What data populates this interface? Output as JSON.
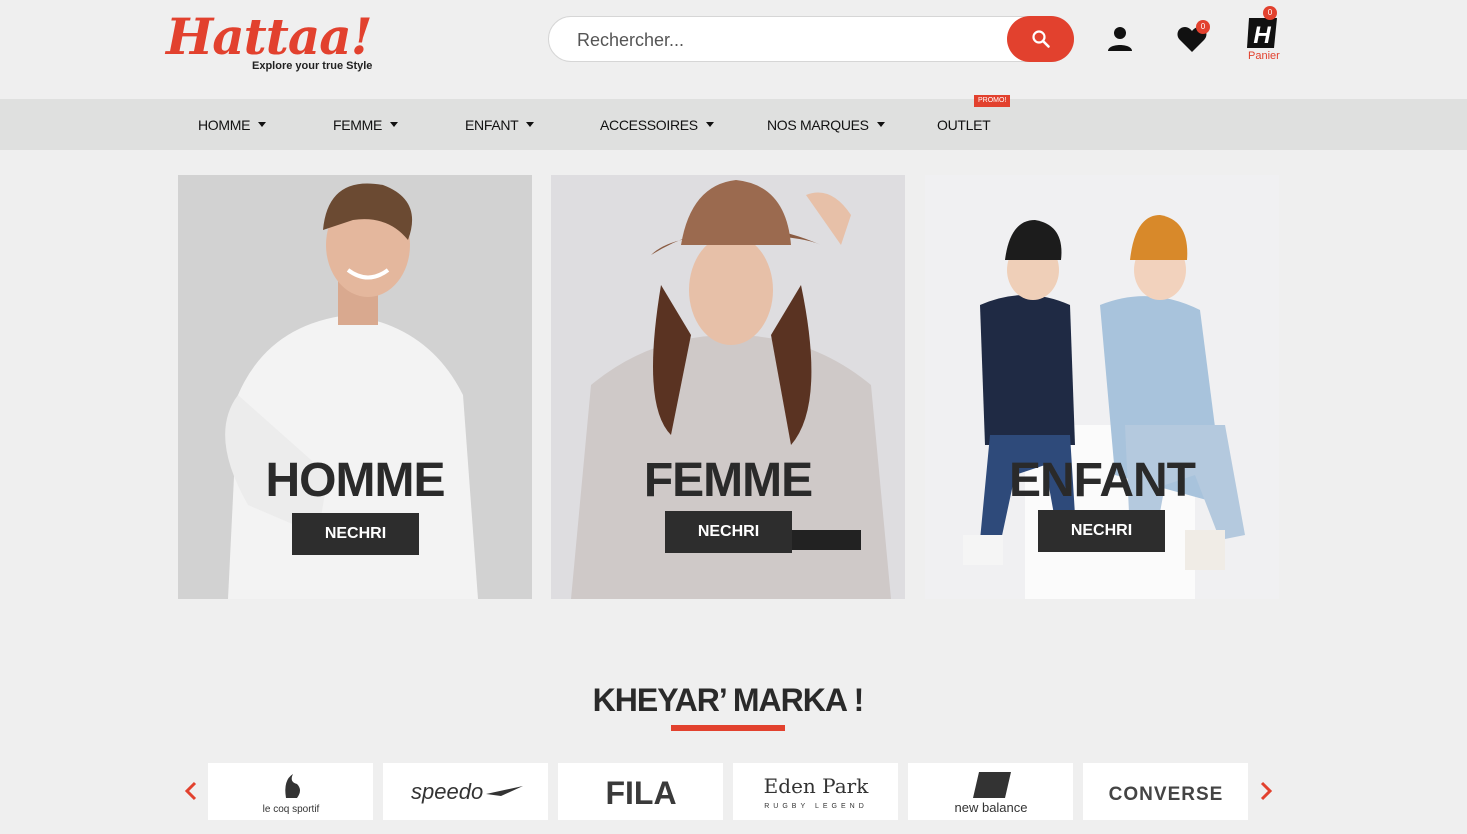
{
  "brand": {
    "logo_text": "Hattaa!",
    "tagline": "Explore your true Style",
    "accent_color": "#e2412e"
  },
  "search": {
    "placeholder": "Rechercher..."
  },
  "header": {
    "wishlist_count": "0",
    "cart_count": "0",
    "cart_label": "Panier"
  },
  "nav": {
    "items": [
      {
        "label": "HOMME",
        "has_dropdown": true
      },
      {
        "label": "FEMME",
        "has_dropdown": true
      },
      {
        "label": "ENFANT",
        "has_dropdown": true
      },
      {
        "label": "ACCESSOIRES",
        "has_dropdown": true
      },
      {
        "label": "NOS MARQUES",
        "has_dropdown": true
      },
      {
        "label": "OUTLET",
        "has_dropdown": false
      }
    ],
    "promo_badge": "PROMO!"
  },
  "categories": [
    {
      "title": "HOMME",
      "button": "NECHRI"
    },
    {
      "title": "FEMME",
      "button": "NECHRI"
    },
    {
      "title": "ENFANT",
      "button": "NECHRI"
    }
  ],
  "brands_section": {
    "title": "KHEYAR’ MARKA !",
    "brands": [
      "le coq sportif",
      "speedo",
      "FILA",
      "Eden Park",
      "new balance",
      "CONVERSE"
    ],
    "eden_sub": "RUGBY LEGEND"
  }
}
